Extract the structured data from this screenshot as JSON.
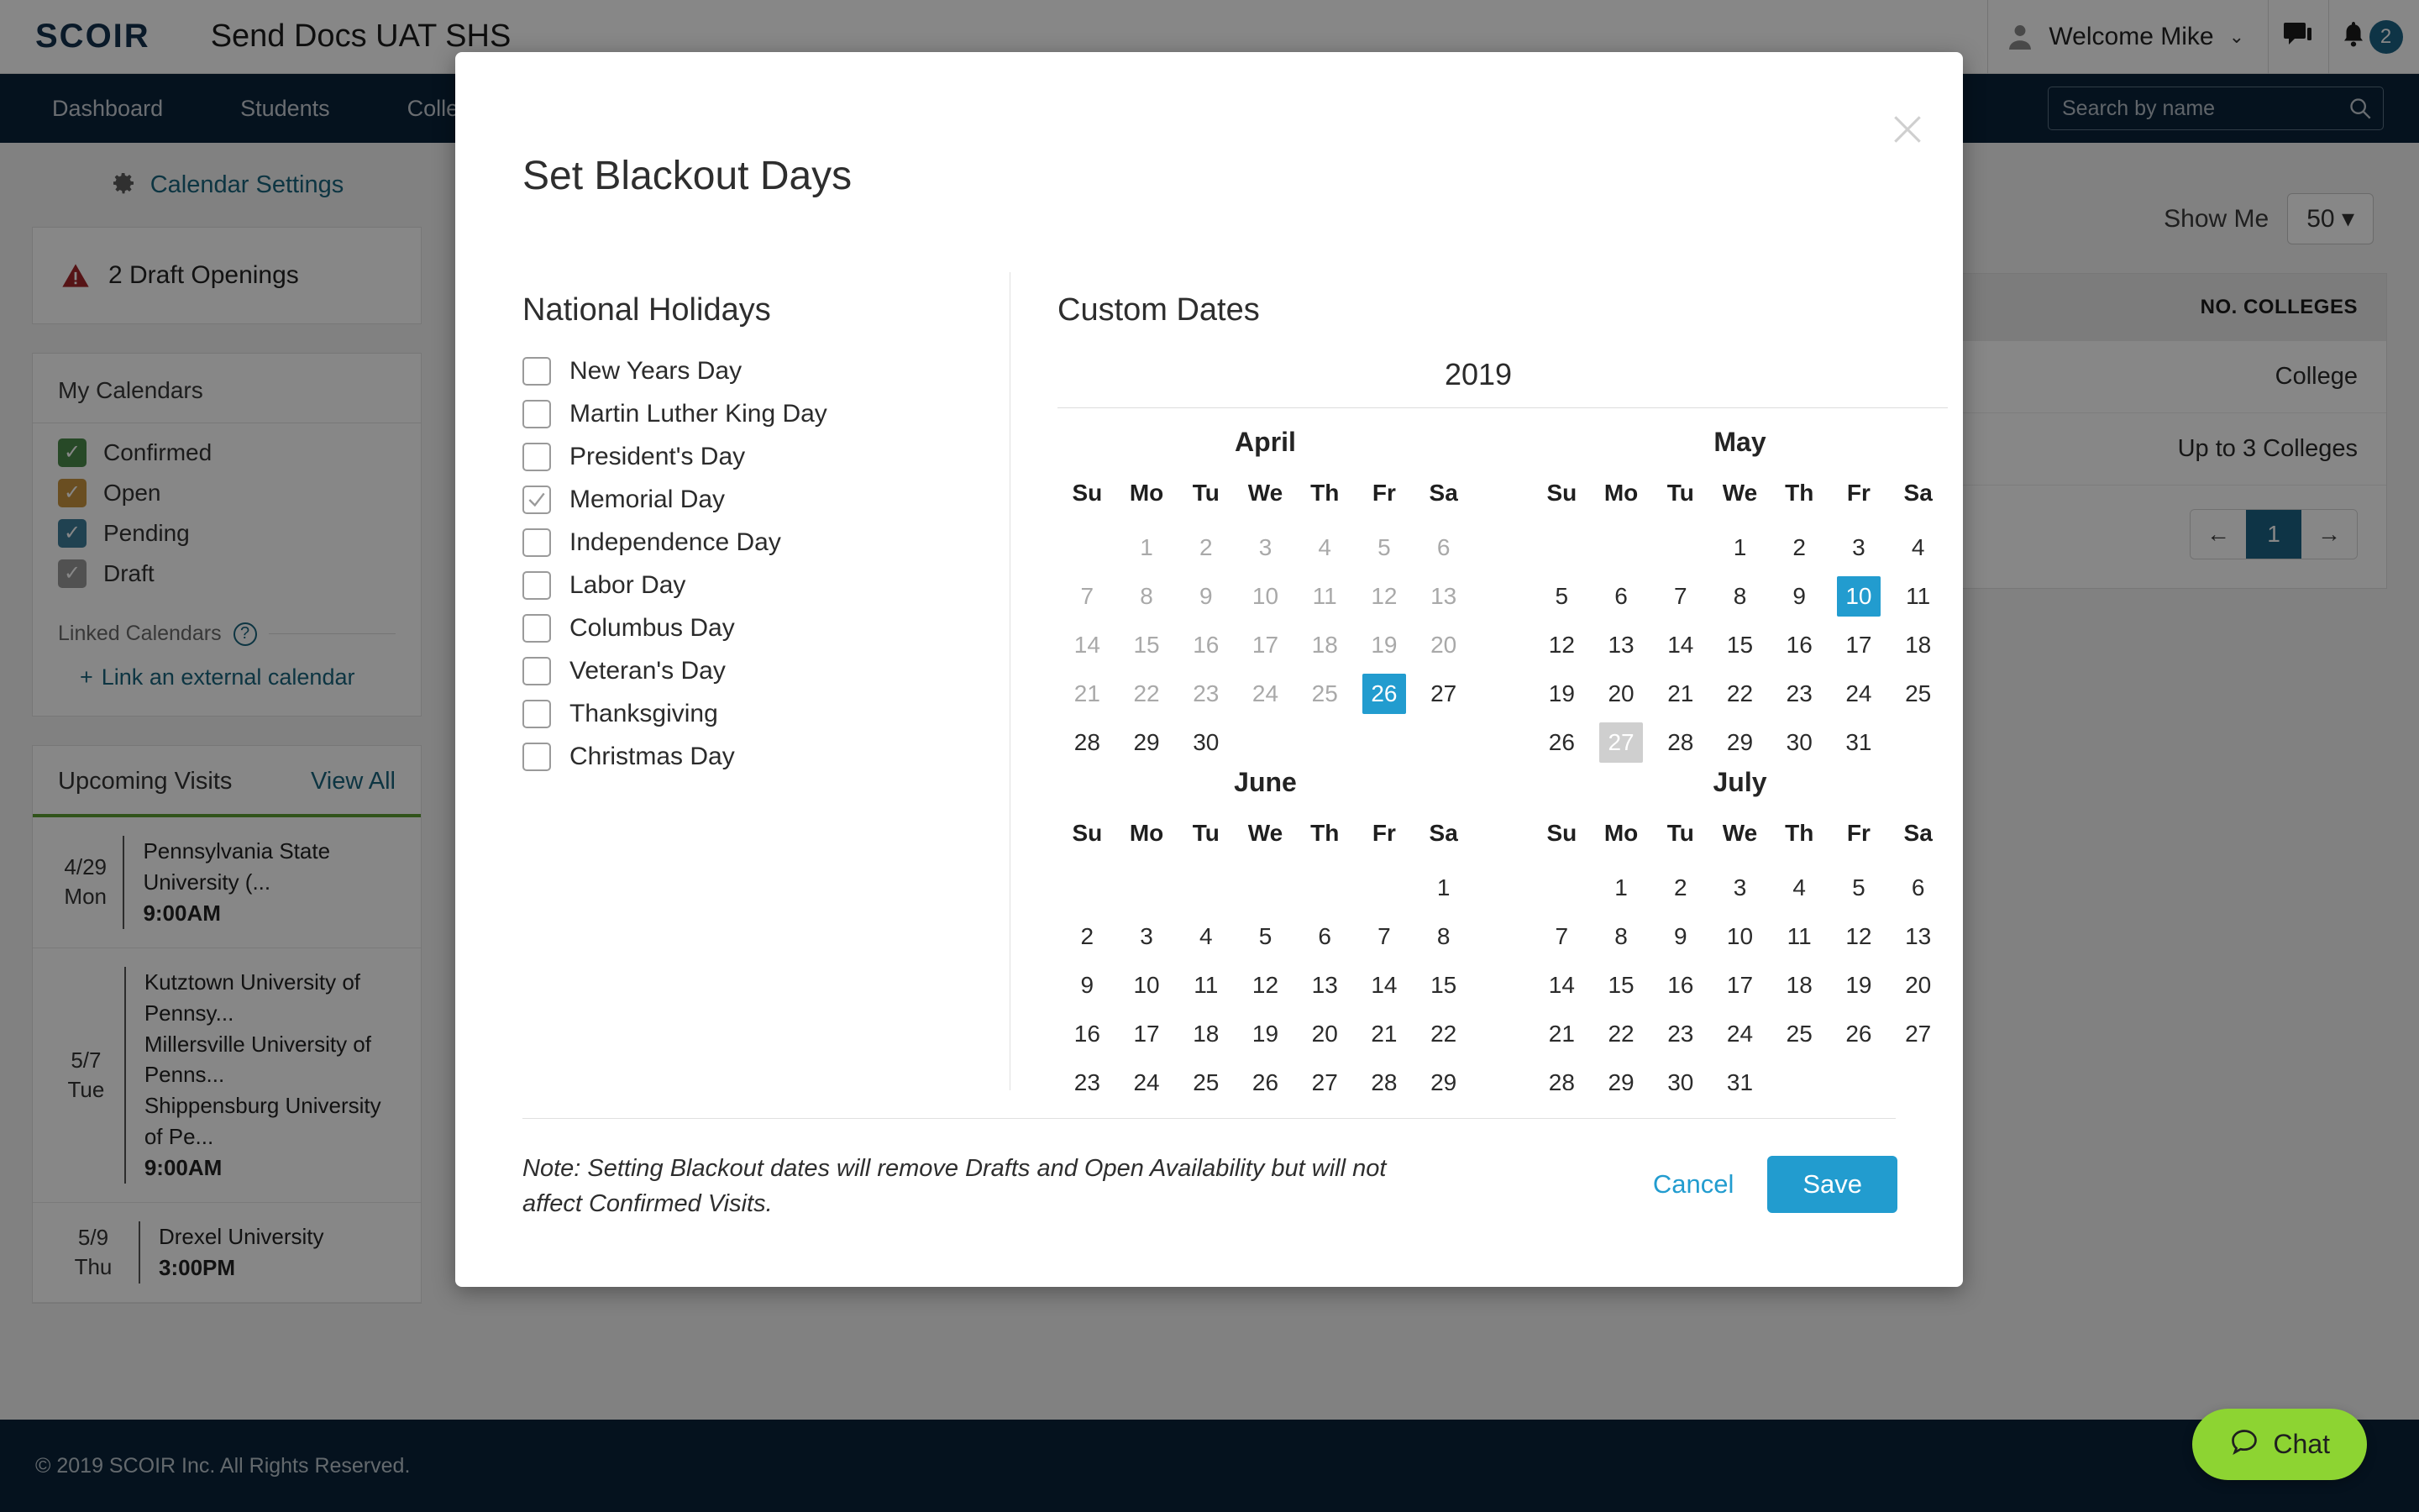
{
  "header": {
    "logo": "SCOIR",
    "org_title": "Send Docs UAT SHS",
    "welcome": "Welcome Mike",
    "caret": "⌄",
    "notification_count": "2",
    "icons": {
      "avatar": "avatar-icon",
      "messages": "chat-bubble-icon",
      "bell": "bell-icon"
    }
  },
  "nav": {
    "items": [
      {
        "label": "Dashboard"
      },
      {
        "label": "Students"
      },
      {
        "label": "Colle"
      }
    ],
    "search_placeholder": "Search by name",
    "search_value": ""
  },
  "sidebar": {
    "calendar_settings": "Calendar Settings",
    "draft_openings": "2 Draft Openings",
    "my_calendars_title": "My Calendars",
    "calendars": [
      {
        "label": "Confirmed",
        "color": "#4a8b4a",
        "checked": true
      },
      {
        "label": "Open",
        "color": "#c8943f",
        "checked": true
      },
      {
        "label": "Pending",
        "color": "#3d7e9a",
        "checked": true
      },
      {
        "label": "Draft",
        "color": "#9a9a9a",
        "checked": true
      }
    ],
    "linked_calendars_label": "Linked Calendars",
    "help_glyph": "?",
    "link_external": "Link an external calendar",
    "plus": "+",
    "upcoming_visits_title": "Upcoming Visits",
    "view_all": "View All",
    "visits": [
      {
        "date": "4/29",
        "dow": "Mon",
        "colleges": [
          "Pennsylvania State University (..."
        ],
        "time": "9:00AM"
      },
      {
        "date": "5/7",
        "dow": "Tue",
        "colleges": [
          "Kutztown University of Pennsy...",
          "Millersville University of Penns...",
          "Shippensburg University of Pe..."
        ],
        "time": "9:00AM"
      },
      {
        "date": "5/9",
        "dow": "Thu",
        "colleges": [
          "Drexel University"
        ],
        "time": "3:00PM"
      }
    ]
  },
  "main": {
    "show_me_label": "Show Me",
    "show_me_value": "50",
    "show_me_caret": "▾",
    "table_header": "NO. COLLEGES",
    "table_rows": [
      "College",
      "Up to 3 Colleges"
    ],
    "pager": {
      "prev": "←",
      "page": "1",
      "next": "→"
    }
  },
  "footer": {
    "copyright": "© 2019 SCOIR Inc. All Rights Reserved."
  },
  "chat": {
    "label": "Chat",
    "color": "#8dd432"
  },
  "modal": {
    "title": "Set Blackout Days",
    "close_glyph": "✕",
    "national_holidays_title": "National Holidays",
    "holidays": [
      {
        "label": "New Years Day",
        "checked": false
      },
      {
        "label": "Martin Luther King Day",
        "checked": false
      },
      {
        "label": "President's Day",
        "checked": false
      },
      {
        "label": "Memorial Day",
        "checked": true
      },
      {
        "label": "Independence Day",
        "checked": false
      },
      {
        "label": "Labor Day",
        "checked": false
      },
      {
        "label": "Columbus Day",
        "checked": false
      },
      {
        "label": "Veteran's Day",
        "checked": false
      },
      {
        "label": "Thanksgiving",
        "checked": false
      },
      {
        "label": "Christmas Day",
        "checked": false
      }
    ],
    "custom_dates_title": "Custom Dates",
    "year": "2019",
    "dow_labels": [
      "Su",
      "Mo",
      "Tu",
      "We",
      "Th",
      "Fr",
      "Sa"
    ],
    "colors": {
      "selected": "#229ccf",
      "holiday": "#cfcfcf",
      "disabled": "#a9a9a9"
    },
    "months": [
      {
        "name": "April",
        "lead_blanks": 1,
        "days": 30,
        "disabled_through": 25,
        "selected": [
          26
        ],
        "holiday": []
      },
      {
        "name": "May",
        "lead_blanks": 3,
        "days": 31,
        "disabled_through": 0,
        "selected": [
          10
        ],
        "holiday": [
          27
        ]
      },
      {
        "name": "June",
        "lead_blanks": 6,
        "days": 30,
        "disabled_through": 0,
        "selected": [],
        "holiday": []
      },
      {
        "name": "July",
        "lead_blanks": 1,
        "days": 31,
        "disabled_through": 0,
        "selected": [],
        "holiday": []
      }
    ],
    "note": "Note: Setting Blackout dates will remove Drafts and Open Availability but will not affect Confirmed Visits.",
    "cancel_label": "Cancel",
    "save_label": "Save"
  }
}
